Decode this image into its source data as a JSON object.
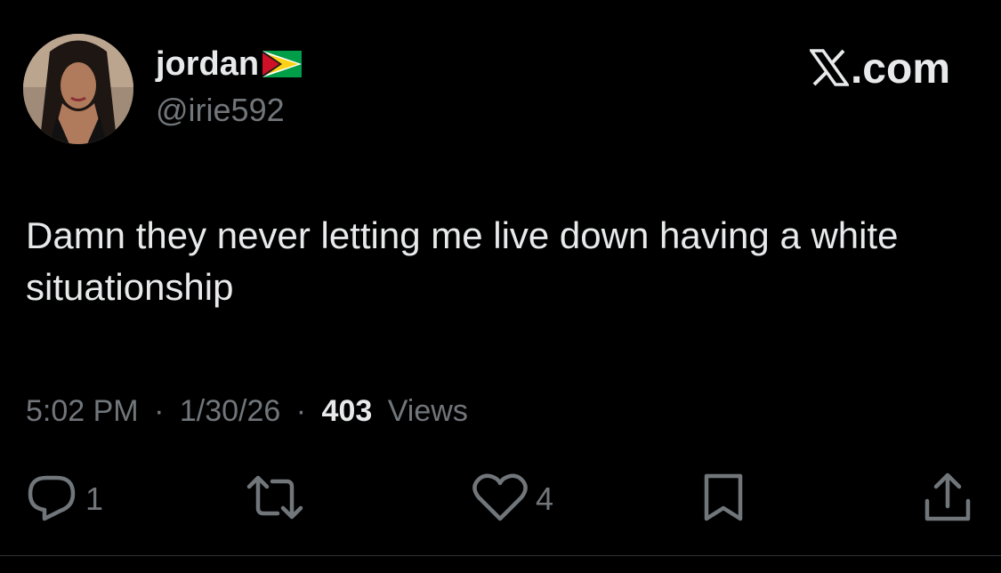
{
  "author": {
    "display_name": "jordan",
    "handle": "@irie592",
    "flag_icon": "guyana-flag-icon",
    "avatar_icon": "profile-avatar"
  },
  "brand": {
    "icon": "x-logo-icon",
    "text": ".com"
  },
  "tweet": {
    "text": "Damn they never letting me live down having a white situationship"
  },
  "meta": {
    "time": "5:02 PM",
    "separator": "·",
    "date": "1/30/26",
    "views_count": "403",
    "views_label": "Views"
  },
  "actions": {
    "reply": {
      "icon": "reply-icon",
      "count": "1"
    },
    "retweet": {
      "icon": "retweet-icon",
      "count": ""
    },
    "like": {
      "icon": "heart-icon",
      "count": "4"
    },
    "bookmark": {
      "icon": "bookmark-icon"
    },
    "share": {
      "icon": "share-icon"
    }
  },
  "colors": {
    "background": "#000000",
    "primary_text": "#e7e9ea",
    "secondary_text": "#71767b",
    "divider": "#2f3336"
  }
}
